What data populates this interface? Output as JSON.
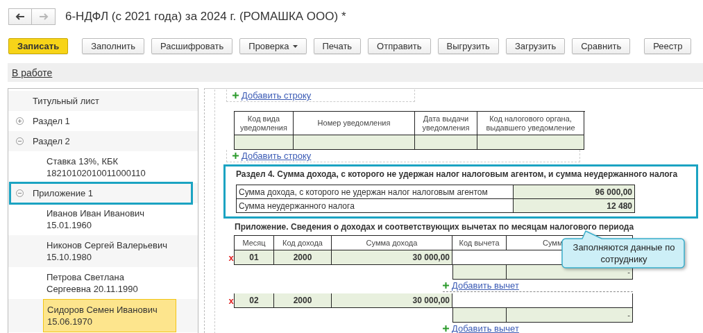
{
  "nav": [
    {
      "kind": "back",
      "disabled": false
    },
    {
      "kind": "forward",
      "disabled": true
    }
  ],
  "window": {
    "title": "6-НДФЛ (с 2021 года) за 2024 г. (РОМАШКА ООО) *"
  },
  "toolbar": [
    {
      "label": "Записать",
      "kind": "primary"
    },
    {
      "label": "Заполнить",
      "kind": "plain"
    },
    {
      "label": "Расшифровать",
      "kind": "plain"
    },
    {
      "label": "Проверка",
      "kind": "dropdown"
    },
    {
      "label": "Печать",
      "kind": "plain"
    },
    {
      "label": "Отправить",
      "kind": "plain"
    },
    {
      "label": "Выгрузить",
      "kind": "plain"
    },
    {
      "label": "Загрузить",
      "kind": "plain"
    },
    {
      "label": "Сравнить",
      "kind": "plain"
    },
    {
      "label": "Реестр",
      "kind": "separated"
    }
  ],
  "status": {
    "label": "В работе"
  },
  "tree": [
    {
      "label": "Титульный лист",
      "selected": false,
      "highlighted": false
    },
    {
      "label": "Раздел 1",
      "expanded": false,
      "selected": false,
      "highlighted": false
    },
    {
      "label": "Раздел 2",
      "expanded": true,
      "selected": false,
      "highlighted": false,
      "children": [
        {
          "label": "Ставка 13%, КБК 18210102010011000110",
          "selected": false,
          "highlighted": false
        }
      ]
    },
    {
      "label": "Приложение 1",
      "expanded": true,
      "selected": false,
      "highlighted": true,
      "children": [
        {
          "label": "Иванов Иван Иванович 15.01.1960",
          "selected": false,
          "highlighted": false
        },
        {
          "label": "Никонов Сергей Валерьевич 15.10.1980",
          "selected": false,
          "highlighted": false
        },
        {
          "label": "Петрова Светлана Сергеевна 20.11.1990",
          "selected": false,
          "highlighted": false
        },
        {
          "label": "Сидоров Семен Иванович 15.06.1970",
          "selected": true,
          "highlighted": false
        }
      ]
    }
  ],
  "form": {
    "top_link": {
      "label": "Добавить строку"
    },
    "notice_table": {
      "columns": [
        "Код вида уведомления",
        "Номер уведомления",
        "Дата выдачи уведомления",
        "Код налогового органа, выдавшего уведомление"
      ]
    },
    "notice_link": {
      "label": "Добавить строку"
    },
    "section4": {
      "title": "Раздел 4. Сумма дохода, с которого не удержан налог налоговым агентом, и сумма неудержанного налога",
      "highlighted": true,
      "rows": [
        {
          "label": "Сумма дохода, с которого не удержан налог налоговым агентом",
          "value": "96 000,00"
        },
        {
          "label": "Сумма неудержанного налога",
          "value": "12 480"
        }
      ]
    },
    "appendix": {
      "title": "Приложение. Сведения о доходах и соответствующих вычетах по месяцам налогового периода",
      "columns": [
        "Месяц",
        "Код дохода",
        "Сумма дохода",
        "Код вычета",
        "Сумм"
      ],
      "months": [
        {
          "delete_mark": "x",
          "month": "01",
          "income_code": "2000",
          "amount": "30 000,00",
          "deductions": [
            {
              "amount": "-"
            }
          ],
          "add_label": "Добавить вычет"
        },
        {
          "delete_mark": "x",
          "month": "02",
          "income_code": "2000",
          "amount": "30 000,00",
          "deductions": [
            {
              "amount": "-"
            }
          ],
          "add_label": "Добавить вычет"
        }
      ]
    }
  },
  "tooltip": {
    "text": "Заполняются данные по сотруднику"
  }
}
